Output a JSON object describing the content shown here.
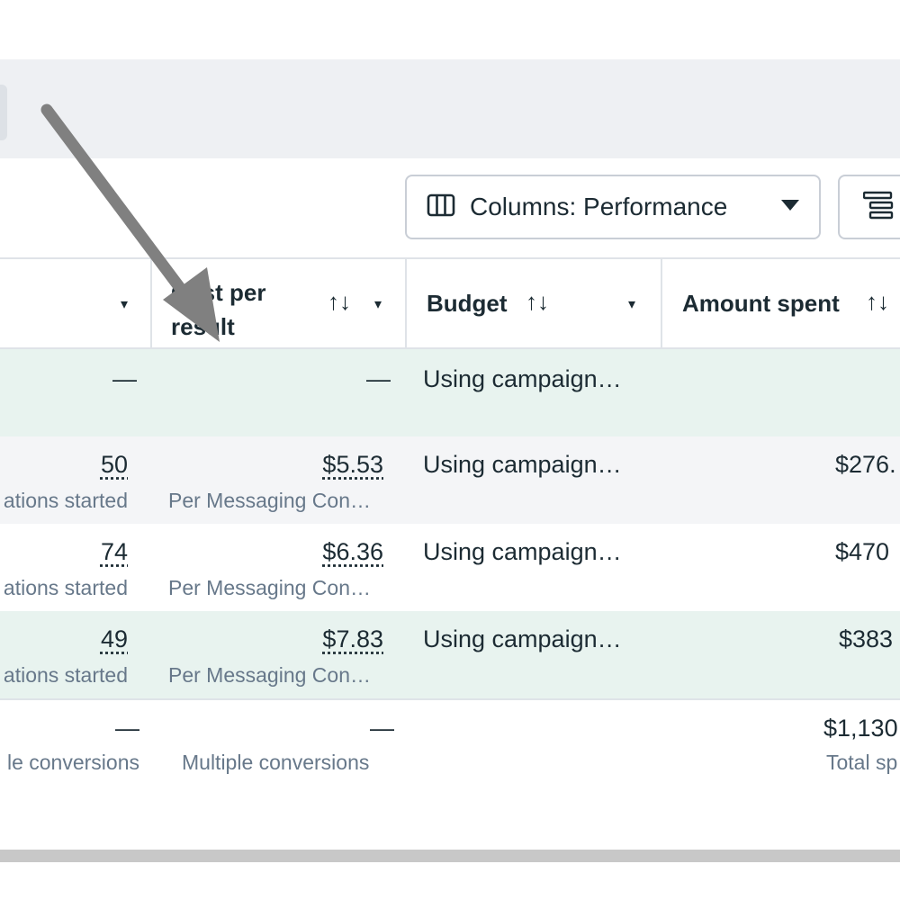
{
  "toolbar": {
    "columns_label": "Columns: Performance",
    "columns_icon": "columns-icon",
    "breakdown_icon": "breakdown-icon"
  },
  "table": {
    "headers": {
      "results_caret": "▾",
      "cost_per_result": "Cost per result",
      "budget": "Budget",
      "amount_spent": "Amount spent",
      "sort_glyph": "↑↓"
    },
    "rows": [
      {
        "results": "—",
        "results_sub": "",
        "cost": "—",
        "cost_sub": "",
        "budget": "Using campaign…",
        "spent": "",
        "spent_sub": ""
      },
      {
        "results": "50",
        "results_sub": "ations started",
        "cost": "$5.53",
        "cost_sub": "Per Messaging Con…",
        "budget": "Using campaign…",
        "spent": "$276.",
        "spent_sub": ""
      },
      {
        "results": "74",
        "results_sub": "ations started",
        "cost": "$6.36",
        "cost_sub": "Per Messaging Con…",
        "budget": "Using campaign…",
        "spent": "$470",
        "spent_sub": ""
      },
      {
        "results": "49",
        "results_sub": "ations started",
        "cost": "$7.83",
        "cost_sub": "Per Messaging Con…",
        "budget": "Using campaign…",
        "spent": "$383",
        "spent_sub": ""
      }
    ],
    "totals": {
      "results": "—",
      "results_sub": "le conversions",
      "cost": "—",
      "cost_sub": "Multiple conversions",
      "spent": "$1,130",
      "spent_sub": "Total sp"
    }
  },
  "annotation": {
    "arrow_color": "#808080"
  }
}
